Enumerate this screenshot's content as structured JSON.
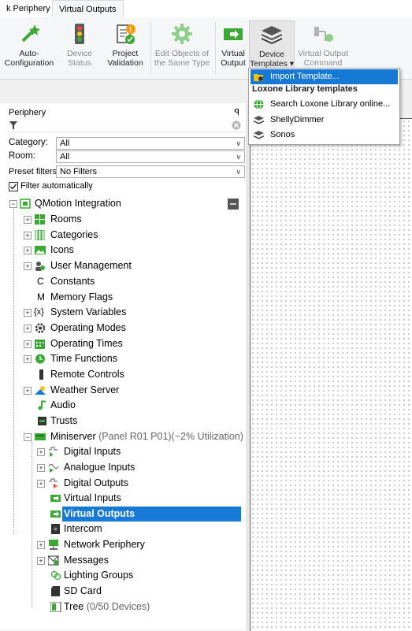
{
  "tabs": [
    "k Periphery",
    "Virtual Outputs"
  ],
  "ribbon": {
    "auto_config": "Auto-\nConfiguration",
    "device_status": "Device\nStatus",
    "project_validation": "Project\nValidation",
    "edit_objects": "Edit Objects of\nthe Same Type",
    "virtual_output": "Virtual\nOutput",
    "device_templates": "Device\nTemplates ▾",
    "virtual_output_command": "Virtual Output\nCommand"
  },
  "templates_menu": {
    "import": "Import Template...",
    "section_header": "Loxone Library templates",
    "search": "Search Loxone Library online...",
    "items": [
      "ShellyDimmer",
      "Sonos"
    ]
  },
  "periphery": {
    "title": "Periphery",
    "pin": "ꟼ",
    "category_label": "Category:",
    "category_value": "All",
    "room_label": "Room:",
    "room_value": "All",
    "preset_label": "Preset filters",
    "preset_value": "No Filters",
    "filter_auto": "Filter automatically"
  },
  "tree": {
    "root": "QMotion Integration",
    "items": [
      "Rooms",
      "Categories",
      "Icons",
      "User Management",
      "Constants",
      "Memory Flags",
      "System Variables",
      "Operating Modes",
      "Operating Times",
      "Time Functions",
      "Remote Controls",
      "Weather Server",
      "Audio",
      "Trusts"
    ],
    "miniserver": "Miniserver",
    "miniserver_note": "(Panel R01 P01)(~2% Utilization)",
    "children": [
      "Digital Inputs",
      "Analogue Inputs",
      "Digital Outputs",
      "Virtual Inputs",
      "Virtual Outputs",
      "Intercom",
      "Network Periphery",
      "Messages",
      "Lighting Groups",
      "SD Card"
    ],
    "tree_label": "Tree",
    "tree_note": "(0/50 Devices)"
  },
  "colors": {
    "accent": "#1779d6",
    "green": "#3aaa35"
  }
}
